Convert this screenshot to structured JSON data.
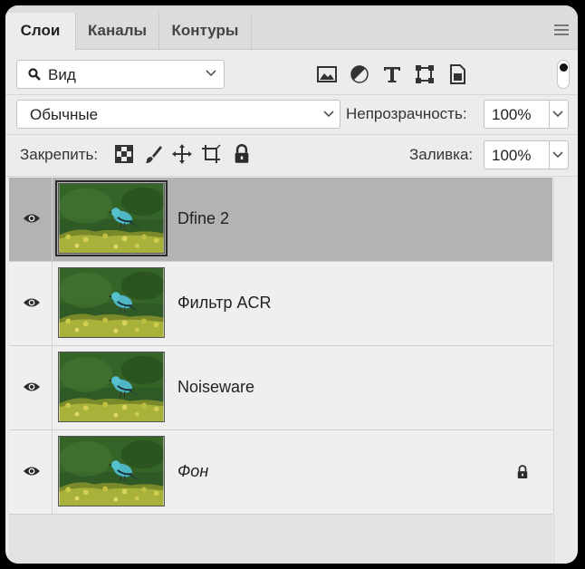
{
  "tabs": [
    {
      "label": "Слои",
      "active": true
    },
    {
      "label": "Каналы",
      "active": false
    },
    {
      "label": "Контуры",
      "active": false
    }
  ],
  "filter": {
    "label": "Вид",
    "icons": [
      "image-filter-icon",
      "adjustment-filter-icon",
      "type-filter-icon",
      "shape-filter-icon",
      "smart-object-filter-icon"
    ]
  },
  "blend": {
    "mode": "Обычные"
  },
  "opacity": {
    "label": "Непрозрачность:",
    "value": "100%"
  },
  "lock": {
    "label": "Закрепить:",
    "icons": [
      "lock-transparency-icon",
      "lock-image-icon",
      "lock-position-icon",
      "lock-artboard-icon",
      "lock-all-icon"
    ]
  },
  "fill": {
    "label": "Заливка:",
    "value": "100%"
  },
  "layers": [
    {
      "name": "Dfine 2",
      "selected": true,
      "italic": false,
      "locked": false
    },
    {
      "name": "Фильтр ACR",
      "selected": false,
      "italic": false,
      "locked": false
    },
    {
      "name": "Noiseware",
      "selected": false,
      "italic": false,
      "locked": false
    },
    {
      "name": "Фон",
      "selected": false,
      "italic": true,
      "locked": true
    }
  ],
  "colors": {
    "panel": "#ececec",
    "selected_row": "#b3b3b3",
    "tabbar": "#dcdcdc"
  }
}
